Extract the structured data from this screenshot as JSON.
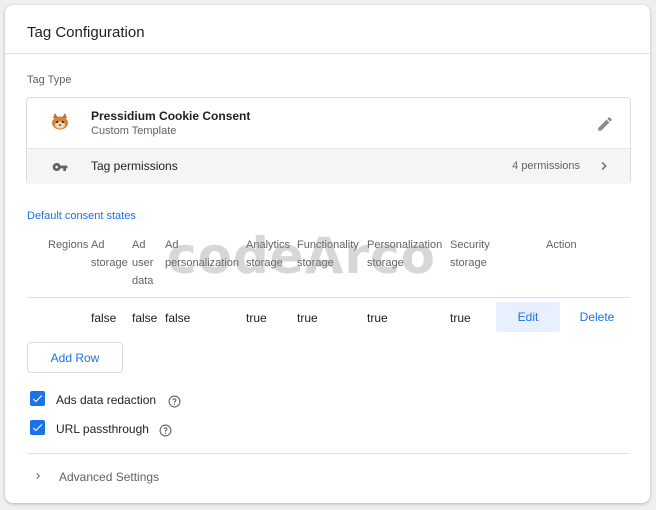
{
  "card": {
    "title": "Tag Configuration"
  },
  "tag_type": {
    "section_label": "Tag Type",
    "template_name": "Pressidium Cookie Consent",
    "template_type": "Custom Template",
    "permissions_label": "Tag permissions",
    "permissions_count": "4 permissions"
  },
  "consent": {
    "title": "Default consent states",
    "headers": {
      "regions": "Regions",
      "ad_storage_1": "Ad",
      "ad_storage_2": "storage",
      "ad_user_data_1": "Ad",
      "ad_user_data_2": "user",
      "ad_user_data_3": "data",
      "ad_personalization_1": "Ad",
      "ad_personalization_2": "personalization",
      "analytics_1": "Analytics",
      "analytics_2": "storage",
      "functionality_1": "Functionality",
      "functionality_2": "storage",
      "personalization_1": "Personalization",
      "personalization_2": "storage",
      "security_1": "Security",
      "security_2": "storage",
      "action": "Action"
    },
    "row": {
      "ad_storage": "false",
      "ad_user_data": "false",
      "ad_personalization": "false",
      "analytics_storage": "true",
      "functionality_storage": "true",
      "personalization_storage": "true",
      "security_storage": "true",
      "edit_label": "Edit",
      "delete_label": "Delete"
    },
    "add_row_label": "Add Row"
  },
  "options": {
    "ads_data_redaction": {
      "label": "Ads data redaction",
      "checked": true
    },
    "url_passthrough": {
      "label": "URL passthrough",
      "checked": true
    }
  },
  "advanced": {
    "label": "Advanced Settings"
  },
  "watermark": "codeArco",
  "icons": {
    "template": "cookie-mascot-icon",
    "edit": "pencil-icon",
    "permissions": "key-icon",
    "chevron": "chevron-right-icon",
    "help": "help-circle-icon",
    "checkbox": "checkmark-icon"
  },
  "colors": {
    "accent": "#1a73e8",
    "edit_bg": "#e8f0fe"
  }
}
